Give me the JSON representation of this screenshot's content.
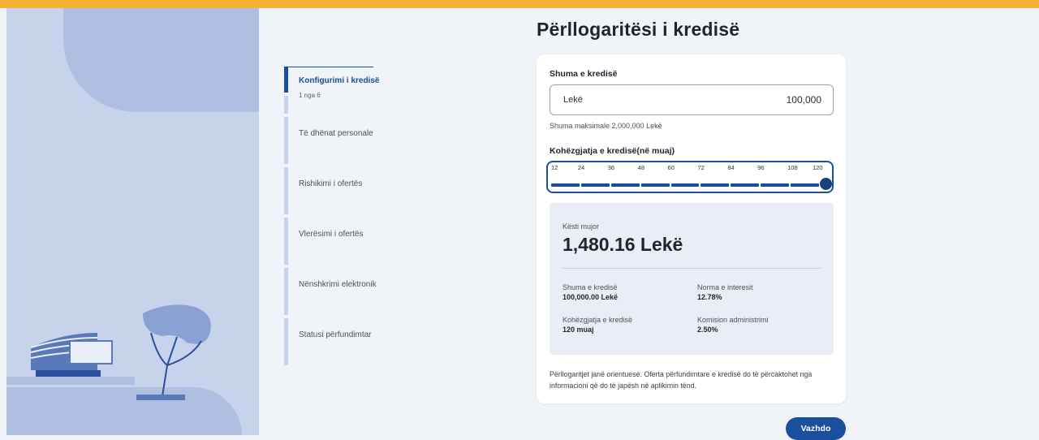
{
  "page": {
    "title": "Përllogaritësi i kredisë",
    "accent": "#f5b335",
    "brand": "#1a4f9e"
  },
  "steps": [
    {
      "label": "Konfigurimi i kredisë",
      "sub": "1 nga 6",
      "active": true
    },
    {
      "label": "Të dhënat personale"
    },
    {
      "label": "Rishikimi i ofertës"
    },
    {
      "label": "Vlerësimi i ofertës"
    },
    {
      "label": "Nënshkrimi elektronik"
    },
    {
      "label": "Statusi përfundimtar"
    }
  ],
  "loan_amount": {
    "label": "Shuma e kredisë",
    "currency": "Lekë",
    "value": "100,000",
    "hint": "Shuma maksimale 2,000,000 Lekë"
  },
  "duration": {
    "label": "Kohëzgjatja e kredisë(në muaj)",
    "ticks": [
      "12",
      "24",
      "36",
      "48",
      "60",
      "72",
      "84",
      "96",
      "108",
      "120"
    ],
    "selected": "120"
  },
  "result": {
    "caption": "Kësti mujor",
    "monthly": "1,480.16 Lekë",
    "items": [
      {
        "k": "Shuma e kredisë",
        "v": "100,000.00 Lekë"
      },
      {
        "k": "Norma e interesit",
        "v": "12.78%"
      },
      {
        "k": "Kohëzgjatja e kredisë",
        "v": "120 muaj"
      },
      {
        "k": "Komision administrimi",
        "v": "2.50%"
      }
    ]
  },
  "note": "Përllogaritjet janë orientuese. Oferta përfundimtare e kredisë do të përcaktohet nga informacioni që do të japësh në aplikimin tënd.",
  "next_label": "Vazhdo"
}
